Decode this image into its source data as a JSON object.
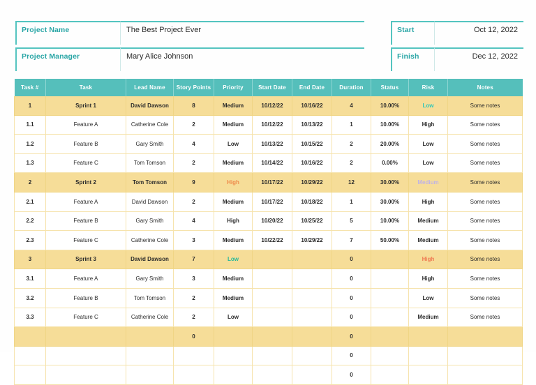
{
  "project": {
    "name_label": "Project Name",
    "name_value": "The Best Project Ever",
    "manager_label": "Project Manager",
    "manager_value": "Mary Alice Johnson",
    "start_label": "Start",
    "start_value": "Oct 12, 2022",
    "finish_label": "Finish",
    "finish_value": "Dec 12, 2022"
  },
  "colors": {
    "header_teal": "#55bfbb",
    "label_teal": "#2aa6a6",
    "sprint_row": "#f6dd98",
    "grid_line": "#f6e3ac",
    "risk_low": "#24c3c3",
    "risk_medium": "#b3a8df",
    "risk_high": "#f2706a"
  },
  "table": {
    "columns": [
      "Task #",
      "Task",
      "Lead Name",
      "Story Points",
      "Priority",
      "Start Date",
      "End Date",
      "Duration",
      "Status",
      "Risk",
      "Notes"
    ],
    "rows": [
      {
        "type": "sprint",
        "num": "1",
        "task": "Sprint 1",
        "lead": "David Dawson",
        "points": "8",
        "priority": "Medium",
        "priority_level": "med",
        "start": "10/12/22",
        "end": "10/16/22",
        "duration": "4",
        "status": "10.00%",
        "risk": "Low",
        "risk_level": "low",
        "notes": "Some notes"
      },
      {
        "type": "task",
        "num": "1.1",
        "task": "Feature A",
        "lead": "Catherine Cole",
        "points": "2",
        "priority": "Medium",
        "priority_level": "med",
        "start": "10/12/22",
        "end": "10/13/22",
        "duration": "1",
        "status": "10.00%",
        "risk": "High",
        "risk_level": "high",
        "notes": "Some notes"
      },
      {
        "type": "task",
        "num": "1.2",
        "task": "Feature B",
        "lead": "Gary Smith",
        "points": "4",
        "priority": "Low",
        "priority_level": "low",
        "start": "10/13/22",
        "end": "10/15/22",
        "duration": "2",
        "status": "20.00%",
        "risk": "Low",
        "risk_level": "low",
        "notes": "Some notes"
      },
      {
        "type": "task",
        "num": "1.3",
        "task": "Feature C",
        "lead": "Tom Tomson",
        "points": "2",
        "priority": "Medium",
        "priority_level": "med",
        "start": "10/14/22",
        "end": "10/16/22",
        "duration": "2",
        "status": "0.00%",
        "risk": "Low",
        "risk_level": "low",
        "notes": "Some notes"
      },
      {
        "type": "sprint",
        "num": "2",
        "task": "Sprint 2",
        "lead": "Tom Tomson",
        "points": "9",
        "priority": "High",
        "priority_level": "high",
        "start": "10/17/22",
        "end": "10/29/22",
        "duration": "12",
        "status": "30.00%",
        "risk": "Medium",
        "risk_level": "med",
        "notes": "Some notes"
      },
      {
        "type": "task",
        "num": "2.1",
        "task": "Feature A",
        "lead": "David Dawson",
        "points": "2",
        "priority": "Medium",
        "priority_level": "med",
        "start": "10/17/22",
        "end": "10/18/22",
        "duration": "1",
        "status": "30.00%",
        "risk": "High",
        "risk_level": "high",
        "notes": "Some notes"
      },
      {
        "type": "task",
        "num": "2.2",
        "task": "Feature B",
        "lead": "Gary Smith",
        "points": "4",
        "priority": "High",
        "priority_level": "high",
        "start": "10/20/22",
        "end": "10/25/22",
        "duration": "5",
        "status": "10.00%",
        "risk": "Medium",
        "risk_level": "med",
        "notes": "Some notes"
      },
      {
        "type": "task",
        "num": "2.3",
        "task": "Feature C",
        "lead": "Catherine Cole",
        "points": "3",
        "priority": "Medium",
        "priority_level": "med",
        "start": "10/22/22",
        "end": "10/29/22",
        "duration": "7",
        "status": "50.00%",
        "risk": "Medium",
        "risk_level": "med",
        "notes": "Some notes"
      },
      {
        "type": "sprint",
        "num": "3",
        "task": "Sprint 3",
        "lead": "David Dawson",
        "points": "7",
        "priority": "Low",
        "priority_level": "low",
        "start": "",
        "end": "",
        "duration": "0",
        "status": "",
        "risk": "High",
        "risk_level": "high",
        "notes": "Some notes"
      },
      {
        "type": "task",
        "num": "3.1",
        "task": "Feature A",
        "lead": "Gary Smith",
        "points": "3",
        "priority": "Medium",
        "priority_level": "med",
        "start": "",
        "end": "",
        "duration": "0",
        "status": "",
        "risk": "High",
        "risk_level": "high",
        "notes": "Some notes"
      },
      {
        "type": "task",
        "num": "3.2",
        "task": "Feature B",
        "lead": "Tom Tomson",
        "points": "2",
        "priority": "Medium",
        "priority_level": "med",
        "start": "",
        "end": "",
        "duration": "0",
        "status": "",
        "risk": "Low",
        "risk_level": "low",
        "notes": "Some notes"
      },
      {
        "type": "task",
        "num": "3.3",
        "task": "Feature C",
        "lead": "Catherine Cole",
        "points": "2",
        "priority": "Low",
        "priority_level": "low",
        "start": "",
        "end": "",
        "duration": "0",
        "status": "",
        "risk": "Medium",
        "risk_level": "med",
        "notes": "Some notes"
      },
      {
        "type": "sprint",
        "num": "",
        "task": "",
        "lead": "",
        "points": "0",
        "priority": "",
        "priority_level": "",
        "start": "",
        "end": "",
        "duration": "0",
        "status": "",
        "risk": "",
        "risk_level": "",
        "notes": ""
      },
      {
        "type": "task",
        "num": "",
        "task": "",
        "lead": "",
        "points": "",
        "priority": "",
        "priority_level": "",
        "start": "",
        "end": "",
        "duration": "0",
        "status": "",
        "risk": "",
        "risk_level": "",
        "notes": ""
      },
      {
        "type": "task",
        "num": "",
        "task": "",
        "lead": "",
        "points": "",
        "priority": "",
        "priority_level": "",
        "start": "",
        "end": "",
        "duration": "0",
        "status": "",
        "risk": "",
        "risk_level": "",
        "notes": ""
      }
    ]
  }
}
